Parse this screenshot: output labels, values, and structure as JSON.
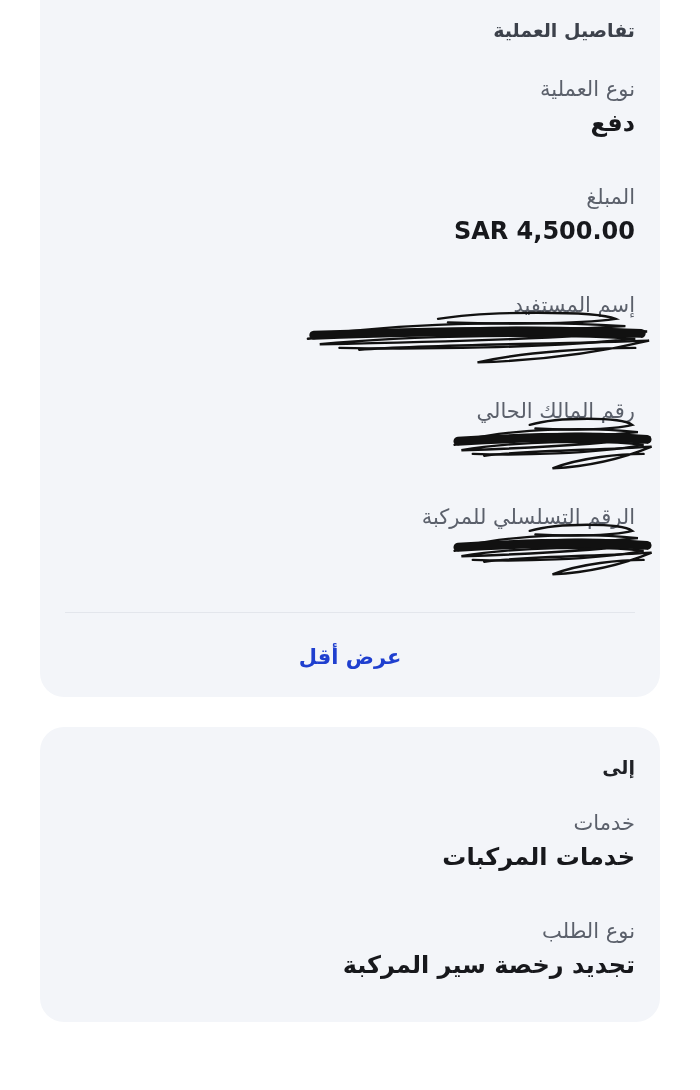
{
  "details_card": {
    "title": "تفاصيل العملية",
    "fields": [
      {
        "kind": "text",
        "label": "نوع العملية",
        "value": "دفع"
      },
      {
        "kind": "text",
        "label": "المبلغ",
        "value": "SAR 4,500.00"
      },
      {
        "kind": "scribble",
        "label": "إسم المستفيد",
        "wide": true
      },
      {
        "kind": "scribble",
        "label": "رقم المالك الحالي",
        "wide": false
      },
      {
        "kind": "scribble",
        "label": "الرقم التسلسلي للمركبة",
        "wide": false
      }
    ],
    "toggle_link": "عرض أقل"
  },
  "recipient_card": {
    "title": "إلى",
    "fields": [
      {
        "kind": "text",
        "label": "خدمات",
        "value": "خدمات المركبات"
      },
      {
        "kind": "text",
        "label": "نوع الطلب",
        "value": "تجديد رخصة سير المركبة"
      }
    ]
  }
}
